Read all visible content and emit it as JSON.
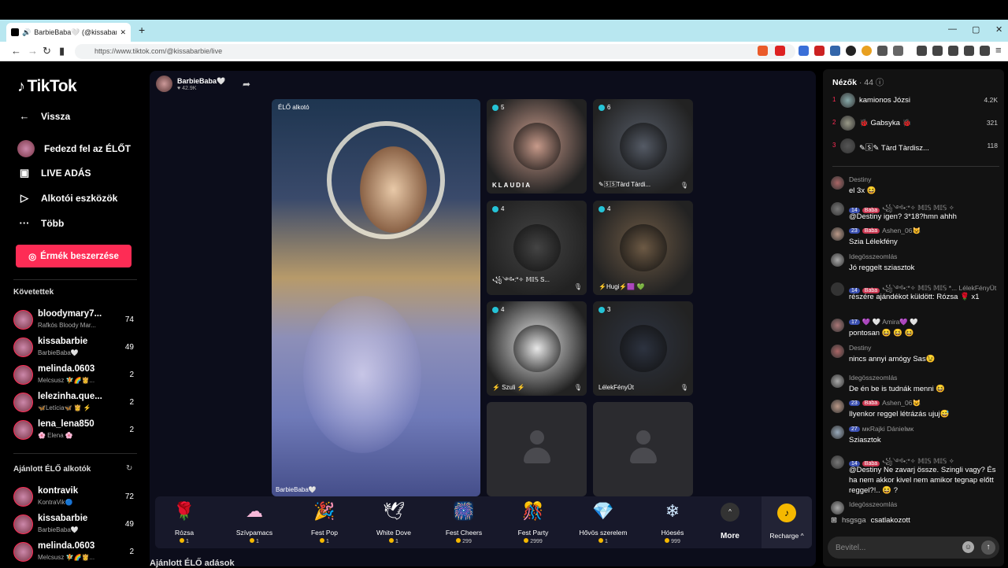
{
  "browser": {
    "tab_title": "BarbieBaba🤍 (@kissabarbie",
    "url": "https://www.tiktok.com/@kissabarbie/live",
    "new_tab": "+",
    "close_tab": "✕",
    "minimize": "—",
    "maximize": "▢",
    "close": "✕"
  },
  "sidebar": {
    "logo": "TikTok",
    "nav": [
      {
        "icon": "←",
        "label": "Vissza"
      },
      {
        "icon": "◉",
        "label": "Fedezd fel az ÉLŐT"
      },
      {
        "icon": "▣",
        "label": "LIVE ADÁS"
      },
      {
        "icon": "▷",
        "label": "Alkotói eszközök"
      },
      {
        "icon": "···",
        "label": "Több"
      }
    ],
    "coins_button": "Érmék beszerzése",
    "following_title": "Követettek",
    "following": [
      {
        "name": "bloodymary7...",
        "sub": "Rafkós Bloody Mar...",
        "count": "74"
      },
      {
        "name": "kissabarbie",
        "sub": "BarbieBaba🤍",
        "count": "49"
      },
      {
        "name": "melinda.0603",
        "sub": "Melcsusz 🧚🌈👸...",
        "count": "2"
      },
      {
        "name": "lelezinha.que...",
        "sub": "🦋Letícia🦋 👸 ⚡",
        "count": "2"
      },
      {
        "name": "lena_lena850",
        "sub": "🌸 Elena 🌸",
        "count": "2"
      }
    ],
    "suggested_title": "Ajánlott ÉLŐ alkotók",
    "suggested": [
      {
        "name": "kontravik",
        "sub": "KontraVik🔵",
        "count": "72"
      },
      {
        "name": "kissabarbie",
        "sub": "BarbieBaba🤍",
        "count": "49"
      },
      {
        "name": "melinda.0603",
        "sub": "Melcsusz 🧚🌈👸...",
        "count": "2"
      }
    ]
  },
  "host": {
    "name": "BarbieBaba🤍",
    "likes": "♥ 42.9K"
  },
  "main_video": {
    "label_top": "ÉLŐ alkotó",
    "label_bottom": "BarbieBaba🤍"
  },
  "guests": [
    {
      "count": "5",
      "name": "KLAUDIA",
      "color": "#c79a8a"
    },
    {
      "count": "6",
      "name": "✎🅂🅂Tàrd Tàrdi...",
      "color": "#555b66"
    },
    {
      "count": "4",
      "name": "꧁༺•:*✧ 𝕄𝕀𝕊 S...",
      "color": "#444"
    },
    {
      "count": "4",
      "name": "⚡Hugi⚡🟪 💚",
      "color": "#6d5a45"
    },
    {
      "count": "4",
      "name": "⚡ Szuli ⚡",
      "color": "#e8e8e8"
    },
    {
      "count": "3",
      "name": "LélekFényÜt",
      "color": "#2d3340"
    }
  ],
  "gifts": [
    {
      "icon": "🌹",
      "name": "Rózsa",
      "price": "1"
    },
    {
      "icon": "☁",
      "name": "Szívpamacs",
      "price": "1"
    },
    {
      "icon": "🎉",
      "name": "Fest Pop",
      "price": "1"
    },
    {
      "icon": "🕊",
      "name": "White Dove",
      "price": "1"
    },
    {
      "icon": "🎆",
      "name": "Fest Cheers",
      "price": "299"
    },
    {
      "icon": "🎊",
      "name": "Fest Party",
      "price": "2999"
    },
    {
      "icon": "💎",
      "name": "Hővös szerelem",
      "price": "1"
    },
    {
      "icon": "❄",
      "name": "Hóesés",
      "price": "999"
    }
  ],
  "more_label": "More",
  "recharge_label": "Recharge ^",
  "bottom_title": "Ajánlott ÉLŐ adások",
  "viewers": {
    "title": "Nézők",
    "count": "· 44",
    "list": [
      {
        "rank": "1",
        "name": "kamionos Józsi",
        "score": "4.2K",
        "color": "#8aa"
      },
      {
        "rank": "2",
        "name": "🐞 Gabsyka 🐞",
        "score": "321",
        "color": "#998"
      },
      {
        "rank": "3",
        "name": "✎🅂✎ Tàrd Tàrdisz...",
        "score": "118",
        "color": "#555"
      }
    ]
  },
  "chat": [
    {
      "user": "Destiny",
      "badges": [],
      "text": "el 3x 😆",
      "color": "#a66"
    },
    {
      "user": "꧁༺•:*✧ 𝕄𝕀𝕊 𝕄𝕀𝕊 ✧",
      "badges": [
        "14",
        "Baba"
      ],
      "text": "@Destiny igen? 3*18?hmn ahhh",
      "color": "#777"
    },
    {
      "user": "Ashen_06😺",
      "badges": [
        "23",
        "Baba"
      ],
      "text": "Szia Lélekfény",
      "color": "#b98"
    },
    {
      "user": "Idegösszeomlás",
      "badges": [],
      "text": "Jó reggelt sziasztok",
      "color": "#aaa"
    },
    {
      "user": "꧁༺•:*✧ 𝕄𝕀𝕊 𝕄𝕀𝕊 *... LélekFényÜt",
      "badges": [
        "14",
        "Baba"
      ],
      "text": "részére ajándékot küldött: Rózsa 🌹 x1",
      "color": "#333"
    },
    {
      "user": "💜 🤍 Amira💜 🤍",
      "badges": [
        "17"
      ],
      "text": "pontosan 😆 😆 😆",
      "color": "#a77"
    },
    {
      "user": "Destiny",
      "badges": [],
      "text": "nincs annyi amógy Sas😉",
      "color": "#a66"
    },
    {
      "user": "Idegösszeomlás",
      "badges": [],
      "text": "De én be is tudnák menni 😆",
      "color": "#aaa"
    },
    {
      "user": "Ashen_06😺",
      "badges": [
        "23",
        "Baba"
      ],
      "text": "Ilyenkor reggel létrázás ujuj😅",
      "color": "#b98"
    },
    {
      "user": "ᴍᴋRajki Dánielᴍᴋ",
      "badges": [
        "27"
      ],
      "text": "Sziasztok",
      "color": "#9ab"
    },
    {
      "user": "꧁༺•:*✧ 𝕄𝕀𝕊 𝕄𝕀𝕊 ✧",
      "badges": [
        "14",
        "Baba"
      ],
      "text": "@Destiny Ne zavarj össze. Szingli vagy? És ha nem akkor kivel nem amikor tegnap előtt reggel?!.. 😆 ?",
      "color": "#777"
    },
    {
      "user": "Idegösszeomlás",
      "badges": [],
      "text": "",
      "color": "#aaa"
    }
  ],
  "join": {
    "user": "hsgsga",
    "text": "csatlakozott"
  },
  "input": {
    "placeholder": "Bevitel..."
  },
  "colors": {
    "accent": "#fe2c55",
    "coin": "#f5b800",
    "live_dot": "#25c3d6"
  }
}
